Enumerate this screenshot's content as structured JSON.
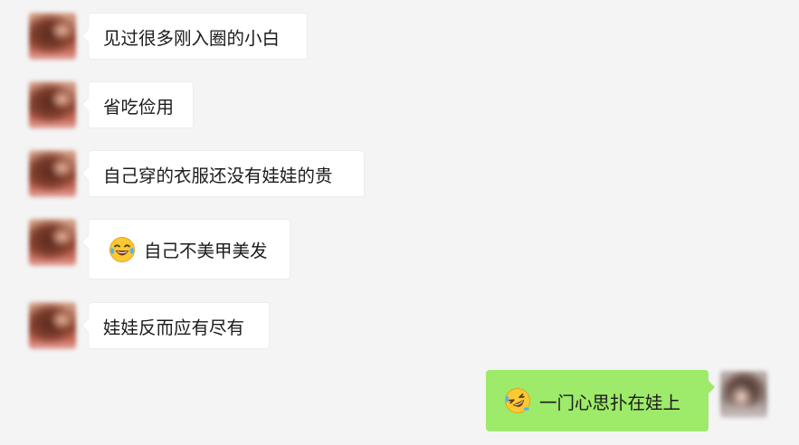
{
  "messages": [
    {
      "side": "left",
      "text": "见过很多刚入圈的小白",
      "emoji": null
    },
    {
      "side": "left",
      "text": "省吃俭用",
      "emoji": null
    },
    {
      "side": "left",
      "text": "自己穿的衣服还没有娃娃的贵",
      "emoji": null
    },
    {
      "side": "left",
      "text": "自己不美甲美发",
      "emoji": "laughing-tears-emoji"
    },
    {
      "side": "left",
      "text": "娃娃反而应有尽有",
      "emoji": null
    },
    {
      "side": "right",
      "text": "一门心思扑在娃上",
      "emoji": "rolling-laughing-emoji"
    }
  ],
  "colors": {
    "background": "#f4f4f4",
    "incoming_bubble": "#ffffff",
    "outgoing_bubble": "#9eea6a",
    "text": "#1b1b1b"
  }
}
